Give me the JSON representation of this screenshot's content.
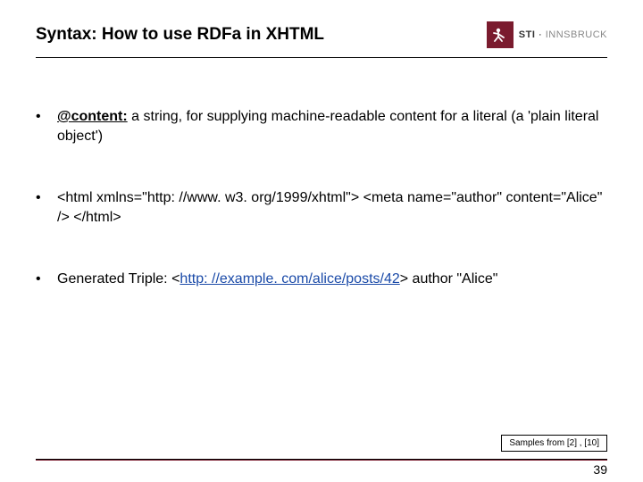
{
  "header": {
    "title": "Syntax: How to use RDFa in XHTML",
    "logo": {
      "sti": "STI",
      "dot": " · ",
      "inns": "INNSBRUCK"
    }
  },
  "bullets": [
    {
      "lead_bold": "@content:",
      "rest": " a string, for supplying machine-readable content for a literal (a 'plain literal object')"
    },
    {
      "plain": "<html xmlns=\"http: //www. w3. org/1999/xhtml\"> <meta name=\"author\" content=\"Alice\" /> </html>"
    },
    {
      "pre": "Generated Triple: <",
      "link": "http: //example. com/alice/posts/42",
      "post": "> author \"Alice\""
    }
  ],
  "footer": {
    "samples": "Samples from [2] , [10]",
    "page": "39"
  }
}
